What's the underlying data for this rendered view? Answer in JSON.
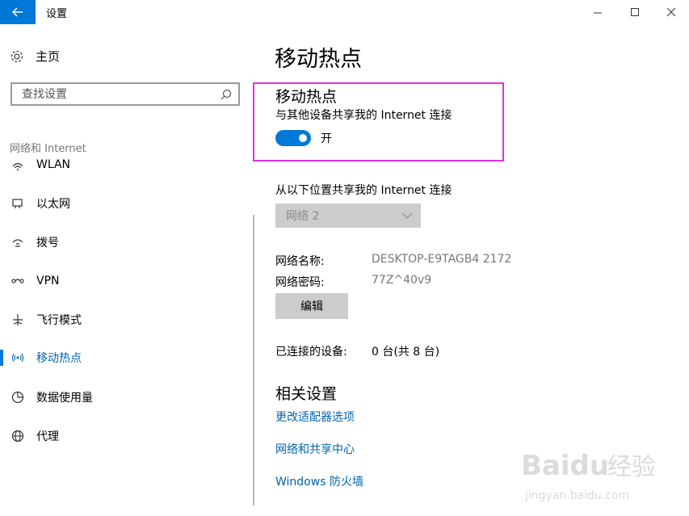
{
  "window": {
    "title": "设置",
    "back_icon": "back-arrow-icon",
    "controls": [
      "minimize",
      "maximize",
      "close"
    ]
  },
  "sidebar": {
    "home_label": "主页",
    "search_placeholder": "查找设置",
    "section_label": "网络和 Internet",
    "items": [
      {
        "label": "WLAN",
        "icon": "wifi-icon"
      },
      {
        "label": "以太网",
        "icon": "ethernet-icon"
      },
      {
        "label": "拨号",
        "icon": "dialup-icon"
      },
      {
        "label": "VPN",
        "icon": "vpn-icon"
      },
      {
        "label": "飞行模式",
        "icon": "airplane-icon"
      },
      {
        "label": "移动热点",
        "icon": "hotspot-icon",
        "active": true
      },
      {
        "label": "数据使用量",
        "icon": "data-usage-icon"
      },
      {
        "label": "代理",
        "icon": "globe-icon"
      }
    ]
  },
  "main": {
    "page_title": "移动热点",
    "hotspot": {
      "title": "移动热点",
      "share_label": "与其他设备共享我的 Internet 连接",
      "toggle_on": true,
      "toggle_state": "开"
    },
    "share_from": {
      "label": "从以下位置共享我的 Internet 连接",
      "selected": "网络 2"
    },
    "network_name_label": "网络名称:",
    "network_name": "DESKTOP-E9TAGB4 2172",
    "network_password_label": "网络密码:",
    "network_password": "77Z^40v9",
    "edit_label": "编辑",
    "connected_label": "已连接的设备:",
    "connected_value": "0 台(共 8 台)",
    "related_title": "相关设置",
    "links": [
      "更改适配器选项",
      "网络和共享中心",
      "Windows 防火墙"
    ]
  },
  "watermark": {
    "brand": "Baidu 经验",
    "url": "jingyan.baidu.com"
  },
  "colors": {
    "accent": "#0078d7",
    "link": "#0063b1",
    "highlight": "#e030e0"
  }
}
